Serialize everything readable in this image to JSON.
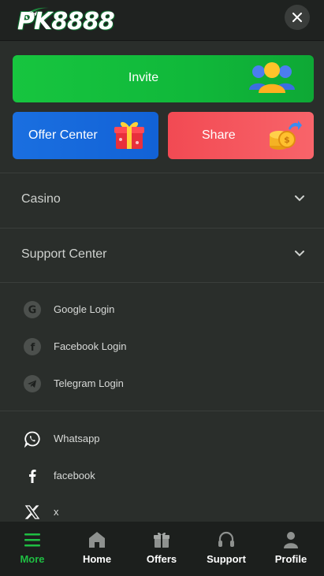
{
  "header": {
    "logo_text": "PK8888",
    "close_icon": "close-icon"
  },
  "promo": {
    "invite_label": "Invite",
    "offer_center_label": "Offer Center",
    "share_label": "Share"
  },
  "sections": [
    {
      "label": "Casino",
      "icon": "chevron-down-icon"
    },
    {
      "label": "Support Center",
      "icon": "chevron-down-icon"
    }
  ],
  "logins": [
    {
      "label": "Google Login",
      "icon": "google-icon"
    },
    {
      "label": "Facebook Login",
      "icon": "facebook-icon"
    },
    {
      "label": "Telegram Login",
      "icon": "telegram-icon"
    }
  ],
  "socials": [
    {
      "label": "Whatsapp",
      "icon": "whatsapp-icon"
    },
    {
      "label": "facebook",
      "icon": "facebook-icon"
    },
    {
      "label": "x",
      "icon": "x-icon"
    }
  ],
  "nav": [
    {
      "label": "More",
      "icon": "menu-icon",
      "active": true
    },
    {
      "label": "Home",
      "icon": "home-icon",
      "active": false
    },
    {
      "label": "Offers",
      "icon": "gift-icon",
      "active": false
    },
    {
      "label": "Support",
      "icon": "headset-icon",
      "active": false
    },
    {
      "label": "Profile",
      "icon": "user-icon",
      "active": false
    }
  ],
  "colors": {
    "accent": "#1fbe43",
    "invite_bg": "#12bd3c",
    "offer_bg": "#1468da",
    "share_bg": "#f55860",
    "panel_bg": "#2a2e2b",
    "nav_bg": "#1c1f1d"
  }
}
